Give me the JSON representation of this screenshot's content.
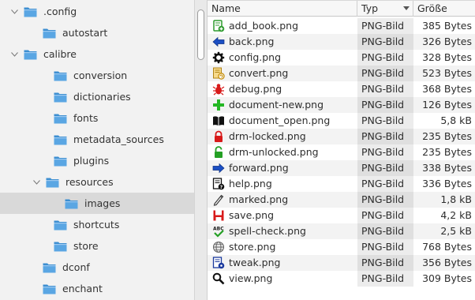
{
  "tree": {
    "items": [
      {
        "label": ".config",
        "expanded": true
      },
      {
        "label": "autostart"
      },
      {
        "label": "calibre",
        "expanded": true
      },
      {
        "label": "conversion"
      },
      {
        "label": "dictionaries"
      },
      {
        "label": "fonts"
      },
      {
        "label": "metadata_sources"
      },
      {
        "label": "plugins"
      },
      {
        "label": "resources",
        "expanded": true
      },
      {
        "label": "images",
        "selected": true
      },
      {
        "label": "shortcuts"
      },
      {
        "label": "store"
      },
      {
        "label": "dconf"
      },
      {
        "label": "enchant"
      }
    ]
  },
  "list": {
    "columns": {
      "name": "Name",
      "type": "Typ",
      "size": "Größe"
    },
    "sort_column": "Typ",
    "files": [
      {
        "name": "add_book.png",
        "type": "PNG-Bild",
        "size": "385 Bytes",
        "icon": "add-book-icon"
      },
      {
        "name": "back.png",
        "type": "PNG-Bild",
        "size": "326 Bytes",
        "icon": "back-arrow-icon"
      },
      {
        "name": "config.png",
        "type": "PNG-Bild",
        "size": "328 Bytes",
        "icon": "gear-icon"
      },
      {
        "name": "convert.png",
        "type": "PNG-Bild",
        "size": "523 Bytes",
        "icon": "convert-icon"
      },
      {
        "name": "debug.png",
        "type": "PNG-Bild",
        "size": "368 Bytes",
        "icon": "bug-icon"
      },
      {
        "name": "document-new.png",
        "type": "PNG-Bild",
        "size": "126 Bytes",
        "icon": "plus-icon"
      },
      {
        "name": "document_open.png",
        "type": "PNG-Bild",
        "size": "5,8 kB",
        "icon": "open-book-icon"
      },
      {
        "name": "drm-locked.png",
        "type": "PNG-Bild",
        "size": "235 Bytes",
        "icon": "lock-closed-icon"
      },
      {
        "name": "drm-unlocked.png",
        "type": "PNG-Bild",
        "size": "235 Bytes",
        "icon": "lock-open-icon"
      },
      {
        "name": "forward.png",
        "type": "PNG-Bild",
        "size": "338 Bytes",
        "icon": "forward-arrow-icon"
      },
      {
        "name": "help.png",
        "type": "PNG-Bild",
        "size": "336 Bytes",
        "icon": "help-icon"
      },
      {
        "name": "marked.png",
        "type": "PNG-Bild",
        "size": "1,8 kB",
        "icon": "pencil-icon"
      },
      {
        "name": "save.png",
        "type": "PNG-Bild",
        "size": "4,2 kB",
        "icon": "save-icon"
      },
      {
        "name": "spell-check.png",
        "type": "PNG-Bild",
        "size": "2,5 kB",
        "icon": "spell-check-icon"
      },
      {
        "name": "store.png",
        "type": "PNG-Bild",
        "size": "768 Bytes",
        "icon": "globe-icon"
      },
      {
        "name": "tweak.png",
        "type": "PNG-Bild",
        "size": "356 Bytes",
        "icon": "tweak-icon"
      },
      {
        "name": "view.png",
        "type": "PNG-Bild",
        "size": "309 Bytes",
        "icon": "magnifier-icon"
      }
    ]
  },
  "colors": {
    "folder_blue": "#3d8fd1",
    "selected_row": "#d9d9d9",
    "tree_background": "#f2f2f2"
  }
}
